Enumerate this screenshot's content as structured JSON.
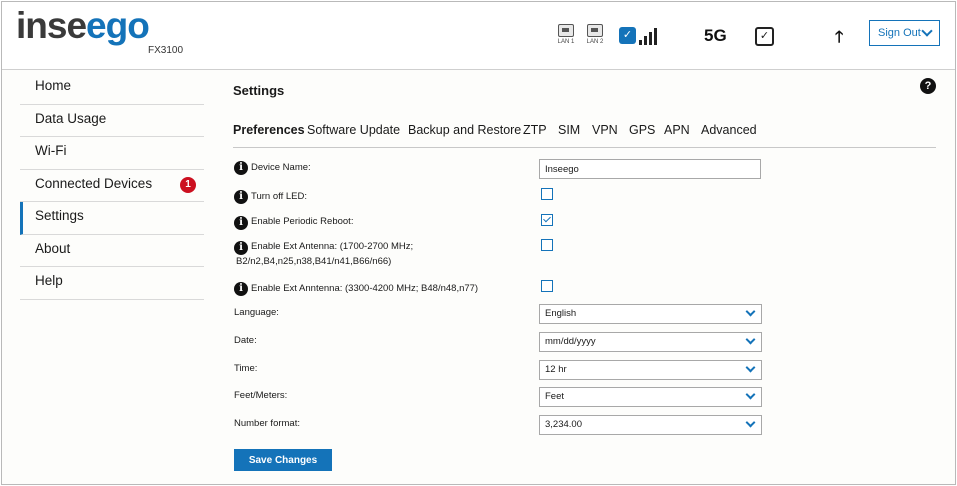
{
  "header": {
    "logo_prefix": "inse",
    "logo_suffix": "ego",
    "model": "FX3100",
    "lan1_label": "LAN 1",
    "lan2_label": "LAN 2",
    "network_label": "5G",
    "sign_out_label": "Sign Out",
    "brand_color": "#1473b9"
  },
  "sidebar": {
    "items": [
      {
        "label": "Home"
      },
      {
        "label": "Data Usage"
      },
      {
        "label": "Wi-Fi"
      },
      {
        "label": "Connected Devices",
        "badge": "1"
      },
      {
        "label": "Settings",
        "active": true
      },
      {
        "label": "About"
      },
      {
        "label": "Help"
      }
    ]
  },
  "main": {
    "title": "Settings",
    "tabs": [
      {
        "label": "Preferences",
        "active": true
      },
      {
        "label": "Software Update"
      },
      {
        "label": "Backup and Restore"
      },
      {
        "label": "ZTP"
      },
      {
        "label": "SIM"
      },
      {
        "label": "VPN"
      },
      {
        "label": "GPS"
      },
      {
        "label": "APN"
      },
      {
        "label": "Advanced"
      }
    ],
    "fields": {
      "device_name_label": "Device Name:",
      "device_name_value": "Inseego",
      "turn_off_led_label": "Turn off LED:",
      "turn_off_led_checked": false,
      "periodic_reboot_label": "Enable Periodic Reboot:",
      "periodic_reboot_checked": true,
      "ext_antenna_label_line1": "Enable Ext Antenna: (1700-2700 MHz;",
      "ext_antenna_label_line2": "B2/n2,B4,n25,n38,B41/n41,B66/n66)",
      "ext_antenna_checked": false,
      "ext_antenna2_label": "Enable Ext Anntenna: (3300-4200 MHz; B48/n48,n77)",
      "ext_antenna2_checked": false,
      "language_label": "Language:",
      "language_value": "English",
      "date_label": "Date:",
      "date_value": "mm/dd/yyyy",
      "time_label": "Time:",
      "time_value": "12 hr",
      "units_label": "Feet/Meters:",
      "units_value": "Feet",
      "number_format_label": "Number format:",
      "number_format_value": "3,234.00"
    },
    "save_label": "Save Changes"
  }
}
